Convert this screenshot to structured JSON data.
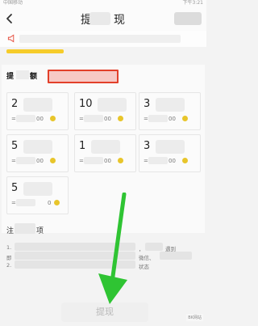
{
  "status_bar": {
    "left": "中国移动",
    "right": "下午3:21"
  },
  "header": {
    "title_start": "提",
    "title_end": "现",
    "back_icon": "chevron-left-icon",
    "action_text": ""
  },
  "notice": {
    "icon": "megaphone-icon"
  },
  "section": {
    "title_start": "提",
    "title_end": "额"
  },
  "amounts": [
    {
      "value": "2",
      "sub": "=",
      "sub_end": "00"
    },
    {
      "value": "10",
      "sub": "=",
      "sub_end": "00"
    },
    {
      "value": "3",
      "sub": "=",
      "sub_end": "00"
    },
    {
      "value": "5",
      "sub": "=",
      "sub_end": "00"
    },
    {
      "value": "1",
      "sub": "=",
      "sub_end": "00"
    },
    {
      "value": "3",
      "sub": "=",
      "sub_end": "00"
    },
    {
      "value": "5",
      "sub": "=",
      "sub_end": "0"
    }
  ],
  "notes": {
    "title_start": "注",
    "title_end": "项",
    "line1": "1.",
    "line1_mid": "，",
    "line1_end": "遇到",
    "line2": "即",
    "line2_mid": "微信、",
    "line3": "2.",
    "line3_end": "状态"
  },
  "withdraw_button": {
    "label": "提现"
  },
  "watermark": {
    "text": "BK网站"
  },
  "colors": {
    "accent_yellow": "#f6cc2a",
    "highlight_red": "#e2402a",
    "arrow_green": "#2fc433"
  }
}
